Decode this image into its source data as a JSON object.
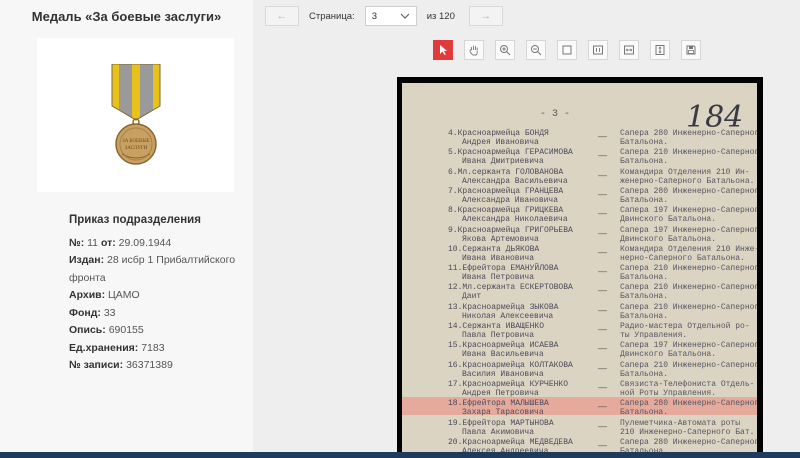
{
  "left": {
    "title": "Медаль «За боевые заслуги»",
    "order_heading": "Приказ подразделения",
    "fields": [
      {
        "label": "№:",
        "value": "11",
        "extra_label": "от:",
        "extra_value": "29.09.1944"
      },
      {
        "label": "Издан:",
        "value": "28 исбр 1 Прибалтийского фронта"
      },
      {
        "label": "Архив:",
        "value": "ЦАМО"
      },
      {
        "label": "Фонд:",
        "value": "33"
      },
      {
        "label": "Опись:",
        "value": "690155"
      },
      {
        "label": "Ед.хранения:",
        "value": "7183"
      },
      {
        "label": "№ записи:",
        "value": "36371389"
      }
    ]
  },
  "pager": {
    "prev": "←",
    "label": "Страница:",
    "current": "3",
    "total": "из 120",
    "next": "→"
  },
  "toolbar": {
    "tools": [
      {
        "name": "select-tool",
        "icon": "cursor-icon",
        "active": true
      },
      {
        "name": "pan-tool",
        "icon": "hand-icon",
        "active": false
      },
      {
        "name": "zoom-in-tool",
        "icon": "zoom-in-icon",
        "active": false
      },
      {
        "name": "zoom-out-tool",
        "icon": "zoom-out-icon",
        "active": false
      },
      {
        "name": "fit-page-tool",
        "icon": "square-icon",
        "active": false
      },
      {
        "name": "actual-size-tool",
        "icon": "one-to-one-icon",
        "active": false
      },
      {
        "name": "fit-width-tool",
        "icon": "fit-width-icon",
        "active": false
      },
      {
        "name": "fit-height-tool",
        "icon": "fit-height-icon",
        "active": false
      },
      {
        "name": "save-tool",
        "icon": "save-icon",
        "active": false
      }
    ],
    "active_color": "#e03a3a"
  },
  "document": {
    "page_number": "- 3 -",
    "handwritten": "184",
    "rows": [
      {
        "n": "4.",
        "rank": "Красноармейца БОНДЯ",
        "name": "Андрея Ивановича",
        "unit1": "Сапера 280 Инженерно-Саперного",
        "unit2": "Батальона."
      },
      {
        "n": "5.",
        "rank": "Красноармейца ГЕРАСИМОВА",
        "name": "Ивана Дмитриевича",
        "unit1": "Сапера 210 Инженерно-Саперного",
        "unit2": "Батальона."
      },
      {
        "n": "6.",
        "rank": "Мл.сержанта ГОЛОВАНОВА",
        "name": "Александра Васильевича",
        "unit1": "Командира Отделения 210 Ин-",
        "unit2": "женерно-Саперного Батальона."
      },
      {
        "n": "7.",
        "rank": "Красноармейца ГРАНЦЕВА",
        "name": "Александра Ивановича",
        "unit1": "Сапера 280 Инженерно-Саперного",
        "unit2": "Батальона."
      },
      {
        "n": "8.",
        "rank": "Красноармейца ГРИЦКЕВА",
        "name": "Александра Николаевича",
        "unit1": "Сапера 197 Инженерно-Саперного",
        "unit2": "Двинского Батальона."
      },
      {
        "n": "9.",
        "rank": "Красноармейца ГРИГОРЬЕВА",
        "name": "Якова Артемовича",
        "unit1": "Сапера 197 Инженерно-Саперного",
        "unit2": "Двинского Батальона."
      },
      {
        "n": "10.",
        "rank": "Сержанта ДЬЯКОВА",
        "name": "Ивана Ивановича",
        "unit1": "Командира Отделения 210 Инже-",
        "unit2": "нерно-Саперного Батальона."
      },
      {
        "n": "11.",
        "rank": "Ефрейтора ЕМАНУЙЛОВА",
        "name": "Ивана Петровича",
        "unit1": "Сапера 210 Инженерно-Саперного",
        "unit2": "Батальона."
      },
      {
        "n": "12.",
        "rank": "Мл.сержанта ЕСКЕРТОВОВА",
        "name": "Даит",
        "unit1": "Сапера 210 Инженерно-Саперного",
        "unit2": "Батальона."
      },
      {
        "n": "13.",
        "rank": "Красноармейца ЗЫКОВА",
        "name": "Николая Алексеевича",
        "unit1": "Сапера 210 Инженерно-Саперного",
        "unit2": "Батальона."
      },
      {
        "n": "14.",
        "rank": "Сержанта ИВАЩЕНКО",
        "name": "Павла Петровича",
        "unit1": "Радио-мастера Отдельной ро-",
        "unit2": "ты Управления."
      },
      {
        "n": "15.",
        "rank": "Красноармейца ИСАЕВА",
        "name": "Ивана Васильевича",
        "unit1": "Сапера 197 Инженерно-Саперного",
        "unit2": "Двинского Батальона."
      },
      {
        "n": "16.",
        "rank": "Красноармейца КОЛТАКОВА",
        "name": "Василия Ивановича",
        "unit1": "Сапера 210 Инженерно-Саперного",
        "unit2": "Батальона."
      },
      {
        "n": "17.",
        "rank": "Красноармейца КУРЧЕНКО",
        "name": "Андрея Петровича",
        "unit1": "Связиста-Телефониста Отдель-",
        "unit2": "ной Роты Управления."
      },
      {
        "n": "18.",
        "rank": "Ефрейтора МАЛЫШЕВА",
        "name": "Захара Тарасовича",
        "unit1": "Сапера 280 Инженерно-Саперного",
        "unit2": "Батальона."
      },
      {
        "n": "19.",
        "rank": "Ефрейтора МАРТЫНОВА",
        "name": "Павла Акимовича",
        "unit1": "Пулеметчика-Автомата роты",
        "unit2": "210 Инженерно-Саперного Бат."
      },
      {
        "n": "20.",
        "rank": "Красноармейца МЕДВЕДЕВА",
        "name": "Алексея Андреевича",
        "unit1": "Сапера 280 Инженерно-Саперного",
        "unit2": "Батальона."
      }
    ],
    "highlight_row": "18.",
    "highlight_color": "#f0786e"
  },
  "colors": {
    "bottom_bar": "#1e3a5c",
    "ribbon_yellow": "#e8c21a",
    "ribbon_gray": "#9a9a9a"
  }
}
